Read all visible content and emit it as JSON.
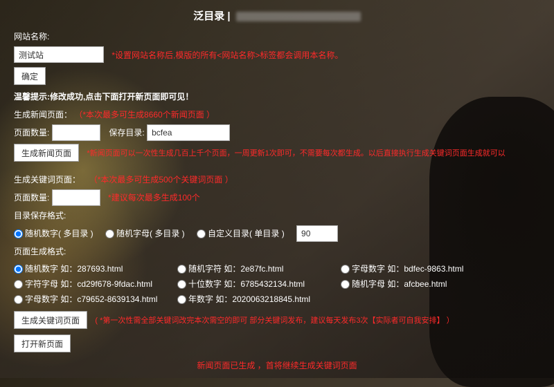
{
  "title_prefix": "泛目录 |",
  "title_rest_hidden": "（标题其余部分被模糊处理）",
  "siteName": {
    "label": "网站名称:",
    "value": "测试站",
    "hint": "*设置网站名称后,模版的所有<网站名称>标签都会调用本名称。",
    "confirm": "确定"
  },
  "successTip": "温馨提示:修改成功,点击下面打开新页面即可见！",
  "news": {
    "heading": "生成新闻页面：",
    "hint_paren": "（*本次最多可生成8660个新闻页面  ）",
    "count_label": "页面数量:",
    "count_value": "",
    "dir_label": "保存目录:",
    "dir_value": "bcfea",
    "button": "生成新闻页面",
    "button_hint": "*新闻页面可以一次性生成几百上千个页面，一周更新1次即可，不需要每次都生成。以后直接执行生成关键词页面生成就可以"
  },
  "keyword": {
    "heading": "生成关键词页面：",
    "hint_paren": "（*本次最多可生成500个关键词页面  ）",
    "count_label": "页面数量:",
    "count_value": "",
    "count_hint": "*建议每次最多生成100个",
    "dir_label": "目录保存格式:",
    "radios": {
      "r1": "随机数字( 多目录 )",
      "r2": "随机字母( 多目录 )",
      "r3": "自定义目录( 单目录 )",
      "custom_value": "90"
    },
    "fmt_label": "页面生成格式:",
    "fmt": {
      "f1": "随机数字 如：287693.html",
      "f2": "随机字符 如：2e87fc.html",
      "f3": "字母数字 如：bdfec-9863.html",
      "f4": "字符字母 如：cd29f678-9fdac.html",
      "f5": "十位数字 如：6785432134.html",
      "f6": "随机字母 如：afcbee.html",
      "f7": "字母数字 如：c79652-8639134.html",
      "f8": "年数字 如：2020063218845.html"
    },
    "button": "生成关键词页面",
    "button_hint": "(  *第一次性需全部关键词改完本次需空的即可  部分关键词发布，建议每天发布3次【实际者可自我安排】 ）",
    "open_button": "打开新页面"
  },
  "footer": "新闻页面已生成 ，首将继续生成关键词页面"
}
